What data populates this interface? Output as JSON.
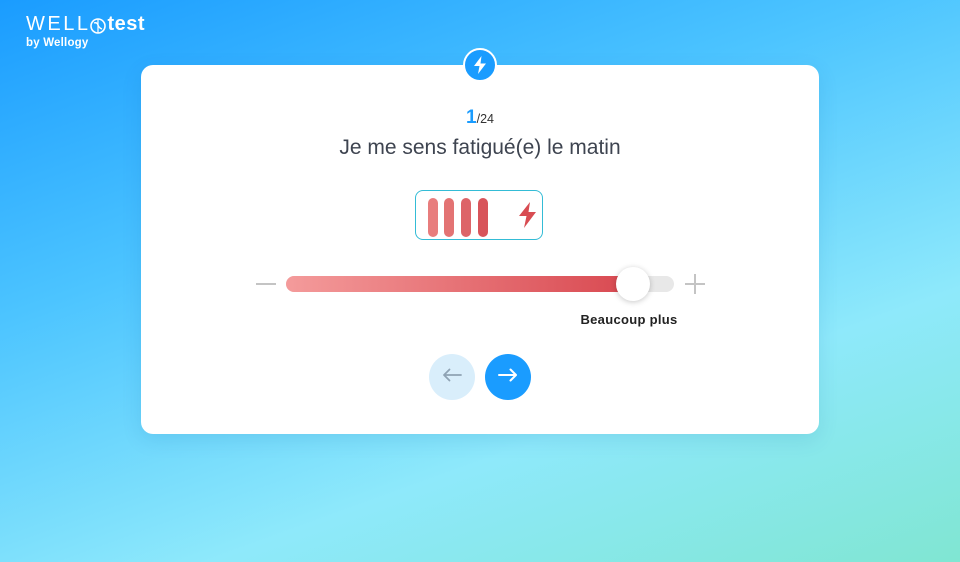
{
  "logo": {
    "brand_prefix": "WELL",
    "brand_suffix": "test",
    "subtitle": "by Wellogy"
  },
  "question": {
    "current": "1",
    "total": "/24",
    "text": "Je me sens fatigué(e) le matin"
  },
  "battery": {
    "filled_bars": 4,
    "bar_colors": [
      "#e87d7d",
      "#e37373",
      "#dd6468",
      "#d8545a"
    ],
    "bolt_color": "#d84c52"
  },
  "slider": {
    "value_fraction": 0.895,
    "label": "Beaucoup plus"
  },
  "colors": {
    "accent": "#1a9cff",
    "slider_start": "#f49b9b",
    "slider_end": "#d8474f",
    "battery_border": "#34bcd6"
  },
  "icons": {
    "top_badge": "lightning-bolt-icon",
    "prev": "arrow-left-icon",
    "next": "arrow-right-icon",
    "decrease": "minus-icon",
    "increase": "plus-icon"
  }
}
